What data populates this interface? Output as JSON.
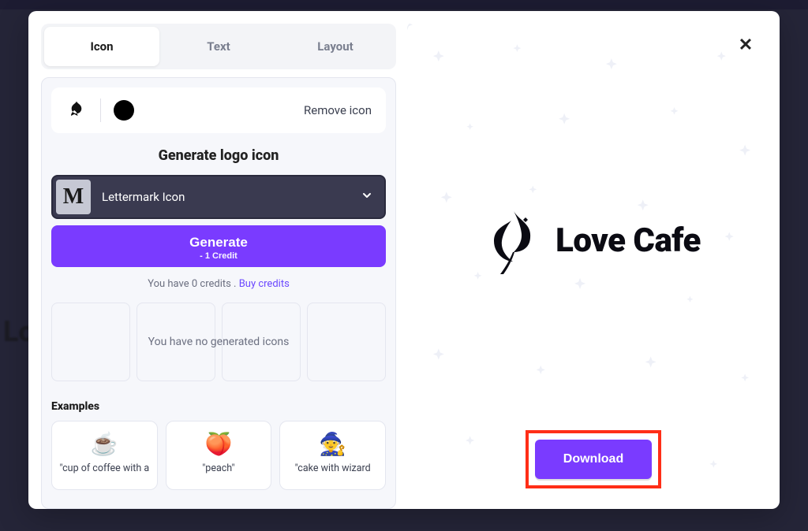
{
  "backdrop": {
    "text_fragment": "Lo"
  },
  "modal": {
    "tabs": {
      "icon": "Icon",
      "text": "Text",
      "layout": "Layout",
      "active": "icon"
    },
    "icon_row": {
      "color_hex": "#000000",
      "remove_label": "Remove icon"
    },
    "generate": {
      "title": "Generate logo icon",
      "dropdown": {
        "badge_letter": "M",
        "label": "Lettermark Icon"
      },
      "button": {
        "main": "Generate",
        "sub": "- 1 Credit"
      },
      "credits_prefix": "You have 0 credits . ",
      "buy_credits": "Buy credits",
      "empty_state": "You have no generated icons"
    },
    "examples": {
      "heading": "Examples",
      "cards": [
        {
          "emoji": "☕",
          "caption": "\"cup of coffee with a"
        },
        {
          "emoji": "🍑",
          "caption": "\"peach\""
        },
        {
          "emoji": "🧙",
          "caption": "\"cake with wizard"
        }
      ]
    },
    "preview": {
      "brand_name": "Love Cafe"
    },
    "download_label": "Download"
  }
}
